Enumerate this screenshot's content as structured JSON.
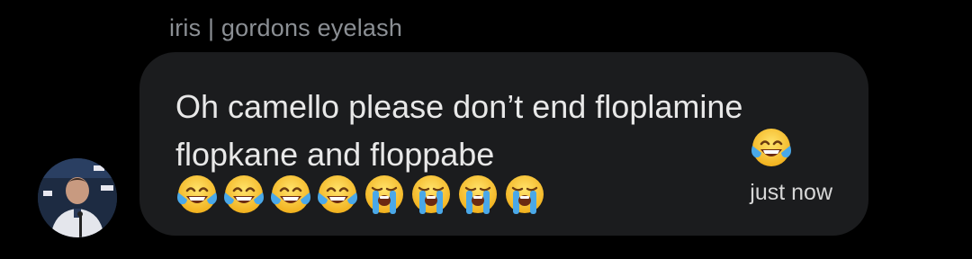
{
  "message": {
    "sender": "iris | gordons eyelash",
    "text": "Oh camello please don’t end floplamine flopkane and floppabe",
    "timestamp": "just now",
    "emojis": [
      "face-with-tears-of-joy",
      "face-with-tears-of-joy",
      "face-with-tears-of-joy",
      "face-with-tears-of-joy",
      "face-with-tears-of-joy",
      "loudly-crying-face",
      "loudly-crying-face",
      "loudly-crying-face",
      "loudly-crying-face"
    ]
  },
  "colors": {
    "background": "#000000",
    "bubble": "#1b1c1e",
    "text": "#e8e8e8",
    "sender_text": "#8b8f94",
    "emoji_yellow": "#f7c634",
    "emoji_tear": "#4aa8e8"
  }
}
